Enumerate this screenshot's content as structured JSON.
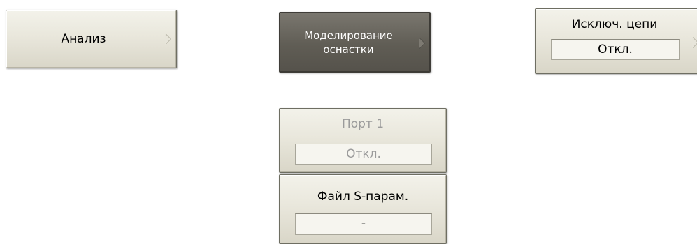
{
  "buttons": {
    "analysis": {
      "label": "Анализ"
    },
    "fixture_simulation": {
      "line1": "Моделирование",
      "line2": "оснастки"
    },
    "deembedding": {
      "title": "Исключ. цепи",
      "value": "Откл."
    },
    "port1": {
      "title": "Порт 1",
      "value": "Откл."
    },
    "sparam_file": {
      "title": "Файл S-парам.",
      "value": "-"
    }
  },
  "colors": {
    "button_face": "#e9e7dc",
    "button_dark_face": "#605d55",
    "disabled_text": "#9b9b9b"
  }
}
